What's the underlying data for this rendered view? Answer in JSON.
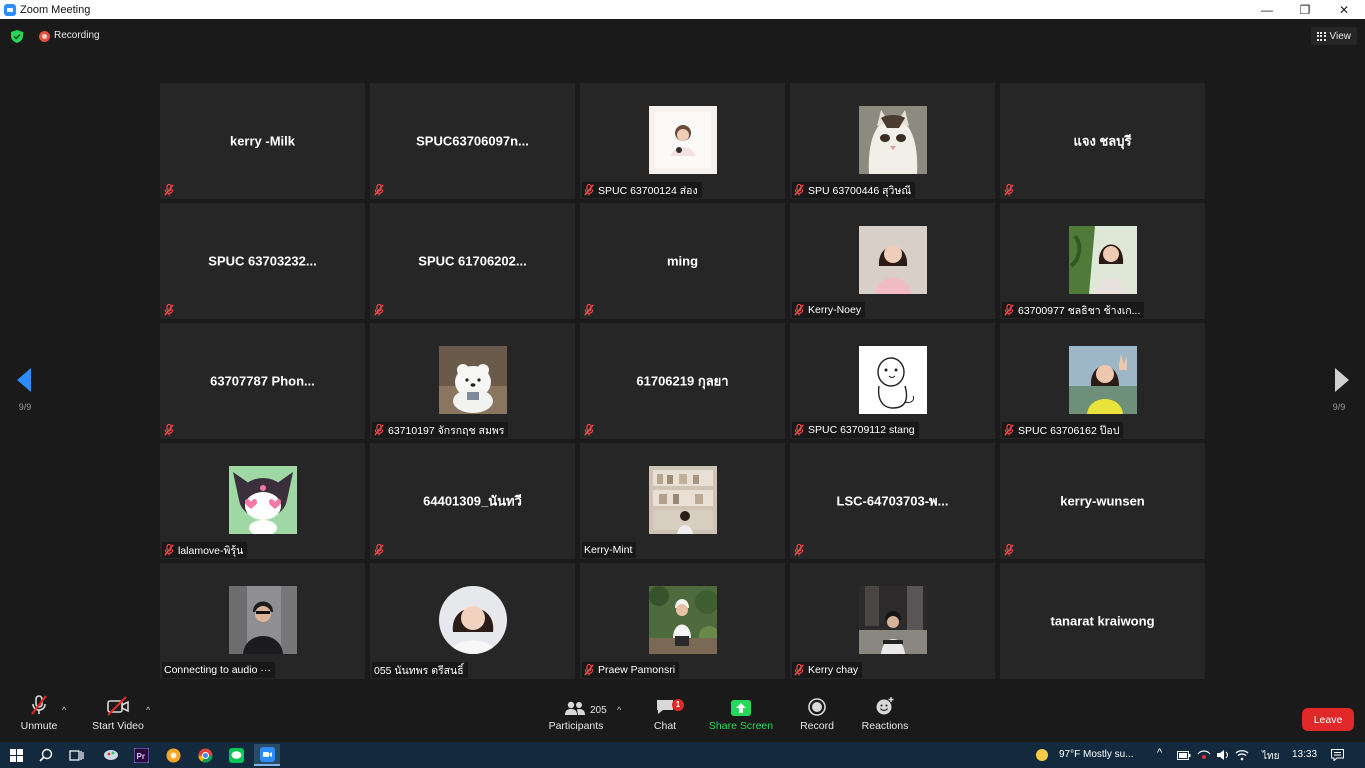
{
  "window": {
    "title": "Zoom Meeting"
  },
  "topbar": {
    "recording_label": "Recording",
    "view_label": "View"
  },
  "pager": {
    "left": "9/9",
    "right": "9/9"
  },
  "tiles": [
    {
      "name": "kerry -Milk",
      "label": "",
      "muted": true,
      "avatar": ""
    },
    {
      "name": "SPUC63706097n...",
      "label": "",
      "muted": true,
      "avatar": ""
    },
    {
      "name": "",
      "label": "SPUC 63700124 ส่อง",
      "muted": true,
      "avatar": "photo-girl-white"
    },
    {
      "name": "",
      "label": "SPU 63700446 สุวิษณี",
      "muted": true,
      "avatar": "photo-cat"
    },
    {
      "name": "แจง ชลบุรี",
      "label": "",
      "muted": true,
      "avatar": ""
    },
    {
      "name": "SPUC 63703232...",
      "label": "",
      "muted": true,
      "avatar": ""
    },
    {
      "name": "SPUC 61706202...",
      "label": "",
      "muted": true,
      "avatar": ""
    },
    {
      "name": "ming",
      "label": "",
      "muted": true,
      "avatar": ""
    },
    {
      "name": "",
      "label": "Kerry-Noey",
      "muted": true,
      "avatar": "photo-girl-pink"
    },
    {
      "name": "",
      "label": "63700977 ชลธิชา  ช้างเก...",
      "muted": true,
      "avatar": "photo-girl-plants"
    },
    {
      "name": "63707787  Phon...",
      "label": "",
      "muted": true,
      "avatar": ""
    },
    {
      "name": "",
      "label": "63710197 จักรกฤช สมพร",
      "muted": true,
      "avatar": "photo-bear"
    },
    {
      "name": "61706219 กุลยา",
      "label": "",
      "muted": true,
      "avatar": ""
    },
    {
      "name": "",
      "label": "SPUC 63709112 stang",
      "muted": true,
      "avatar": "photo-sketch"
    },
    {
      "name": "",
      "label": "SPUC 63706162 ป๊อป",
      "muted": true,
      "avatar": "photo-girl-peace"
    },
    {
      "name": "",
      "label": "lalamove-พิรุ้น",
      "muted": true,
      "avatar": "photo-kuromi"
    },
    {
      "name": "64401309_นันทวี",
      "label": "",
      "muted": true,
      "avatar": ""
    },
    {
      "name": "",
      "label": "Kerry-Mint",
      "muted": false,
      "avatar": "photo-shelves"
    },
    {
      "name": "LSC-64703703-พ...",
      "label": "",
      "muted": true,
      "avatar": ""
    },
    {
      "name": "kerry-wunsen",
      "label": "",
      "muted": true,
      "avatar": ""
    },
    {
      "name": "",
      "label": "Connecting to audio ···",
      "muted": false,
      "avatar": "photo-man-street"
    },
    {
      "name": "",
      "label": "055 นันทพร ตรีสนธิ์",
      "muted": false,
      "avatar": "photo-round-girl"
    },
    {
      "name": "",
      "label": "Praew Pamonsri",
      "muted": true,
      "avatar": "photo-girl-garden"
    },
    {
      "name": "",
      "label": "Kerry chay",
      "muted": true,
      "avatar": "photo-dark-room"
    },
    {
      "name": "tanarat kraiwong",
      "label": "",
      "muted": false,
      "avatar": ""
    }
  ],
  "toolbar": {
    "unmute": "Unmute",
    "start_video": "Start Video",
    "participants": "Participants",
    "participants_count": "205",
    "chat": "Chat",
    "chat_badge": "1",
    "share_screen": "Share Screen",
    "record": "Record",
    "reactions": "Reactions",
    "leave": "Leave",
    "share_color": "#23d959",
    "leave_color": "#e02828"
  },
  "taskbar": {
    "weather": "97°F  Mostly su...",
    "language": "ไทย",
    "time": "13:33"
  }
}
